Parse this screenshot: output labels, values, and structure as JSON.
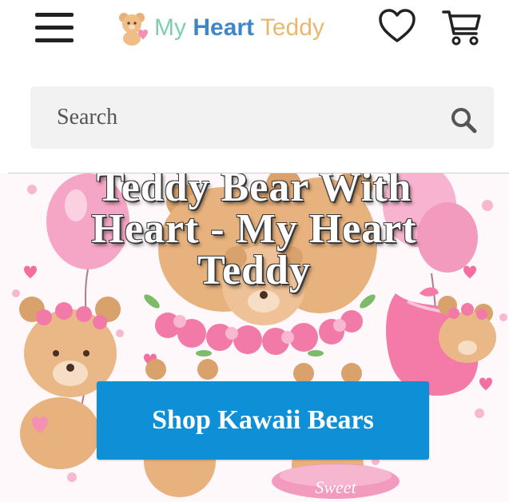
{
  "header": {
    "logo": {
      "part1": "My",
      "part2": "Heart",
      "part3": "Teddy"
    }
  },
  "search": {
    "placeholder": "Search"
  },
  "hero": {
    "title": "Teddy Bear With Heart - My Heart Teddy",
    "cta_label": "Shop Kawaii Bears",
    "sticker_text": "Sweet"
  },
  "colors": {
    "accent": "#0f8fd6",
    "search_bg": "#f2f2f2",
    "logo_my": "#7dcfb0",
    "logo_heart": "#3f86c9",
    "logo_teddy": "#e9b86b"
  }
}
